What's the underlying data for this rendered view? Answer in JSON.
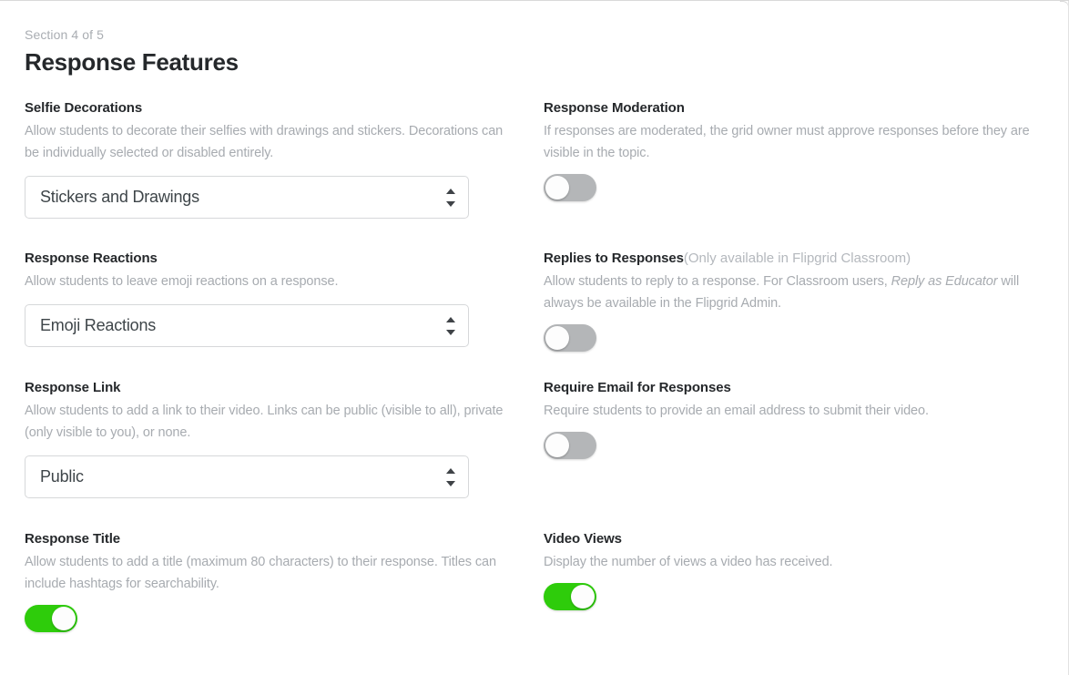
{
  "header": {
    "section_label": "Section 4 of 5",
    "title": "Response Features"
  },
  "theme": {
    "toggle_on_color": "#2ecc0b",
    "toggle_off_color": "#b4b6b8",
    "title_color": "#25282b",
    "muted_text_color": "#a7abb0"
  },
  "fields": {
    "selfie_decorations": {
      "title": "Selfie Decorations",
      "description": "Allow students to decorate their selfies with drawings and stickers. Decorations can be individually selected or disabled entirely.",
      "control": "select",
      "value": "Stickers and Drawings"
    },
    "response_moderation": {
      "title": "Response Moderation",
      "description": "If responses are moderated, the grid owner must approve responses before they are visible in the topic.",
      "control": "toggle",
      "state": "off"
    },
    "response_reactions": {
      "title": "Response Reactions",
      "description": "Allow students to leave emoji reactions on a response.",
      "control": "select",
      "value": "Emoji Reactions"
    },
    "replies_to_responses": {
      "title": "Replies to Responses",
      "title_note": "(Only available in Flipgrid Classroom)",
      "description_part1": "Allow students to reply to a response.  For Classroom users, ",
      "description_emphasis": "Reply as Educator",
      "description_part2": " will always be available in the Flipgrid Admin.",
      "control": "toggle",
      "state": "off"
    },
    "response_link": {
      "title": "Response Link",
      "description": "Allow students to add a link to their video. Links can be public (visible to all), private (only visible to you), or none.",
      "control": "select",
      "value": "Public"
    },
    "require_email": {
      "title": "Require Email for Responses",
      "description": "Require students to provide an email address to submit their video.",
      "control": "toggle",
      "state": "off"
    },
    "response_title": {
      "title": "Response Title",
      "description": "Allow students to add a title (maximum 80 characters) to their response. Titles can include hashtags for searchability.",
      "control": "toggle",
      "state": "on"
    },
    "video_views": {
      "title": "Video Views",
      "description": "Display the number of views a video has received.",
      "control": "toggle",
      "state": "on"
    }
  }
}
